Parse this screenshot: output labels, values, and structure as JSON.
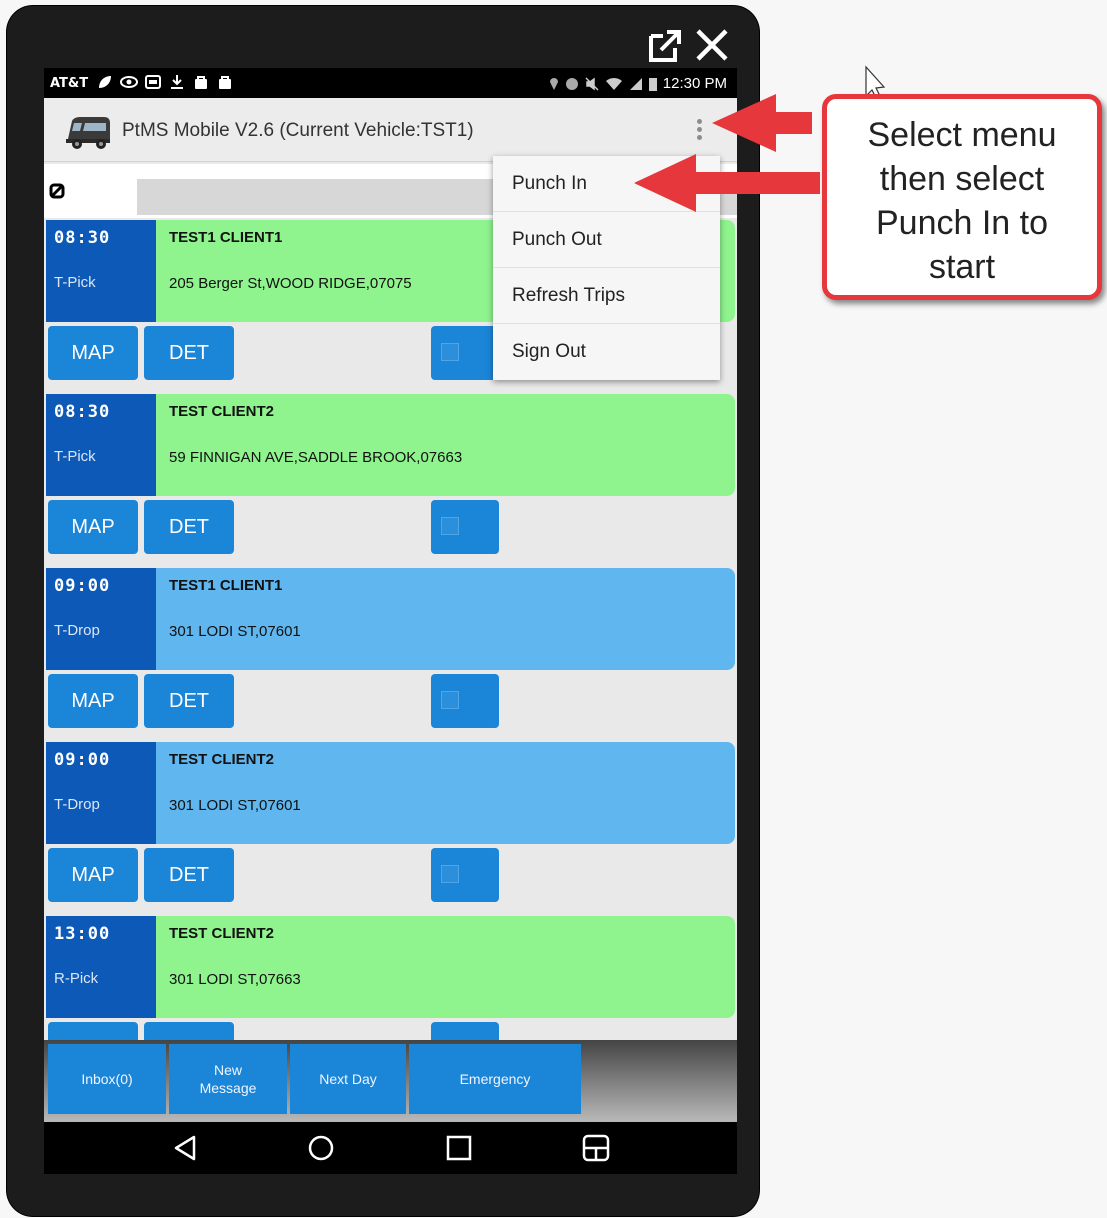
{
  "status_bar": {
    "carrier": "AT&T",
    "time": "12:30 PM"
  },
  "app_bar": {
    "title": "PtMS Mobile V2.6  (Current Vehicle:TST1)"
  },
  "menu": {
    "items": [
      {
        "label": "Punch In"
      },
      {
        "label": "Punch Out"
      },
      {
        "label": "Refresh Trips"
      },
      {
        "label": "Sign Out"
      }
    ]
  },
  "trips": [
    {
      "time": "08:30",
      "type": "T-Pick",
      "name": "TEST1 CLIENT1",
      "address": "205 Berger St,WOOD RIDGE,07075",
      "status_color": "#8ff48e",
      "map_label": "MAP",
      "det_label": "DET"
    },
    {
      "time": "08:30",
      "type": "T-Pick",
      "name": "TEST CLIENT2",
      "address": "59 FINNIGAN AVE,SADDLE BROOK,07663",
      "status_color": "#8ff48e",
      "map_label": "MAP",
      "det_label": "DET"
    },
    {
      "time": "09:00",
      "type": "T-Drop",
      "name": "TEST1 CLIENT1",
      "address": "301 LODI ST,07601",
      "status_color": "#60b6ef",
      "map_label": "MAP",
      "det_label": "DET"
    },
    {
      "time": "09:00",
      "type": "T-Drop",
      "name": "TEST CLIENT2",
      "address": "301 LODI ST,07601",
      "status_color": "#60b6ef",
      "map_label": "MAP",
      "det_label": "DET"
    },
    {
      "time": "13:00",
      "type": "R-Pick",
      "name": "TEST CLIENT2",
      "address": "301 LODI ST,07663",
      "status_color": "#8ff48e"
    }
  ],
  "toolbar": {
    "inbox": "Inbox(0)",
    "new_message_line1": "New",
    "new_message_line2": "Message",
    "next_day": "Next Day",
    "emergency": "Emergency"
  },
  "callout": {
    "line1": "Select menu",
    "line2": "then select",
    "line3": "Punch In to",
    "line4": "start"
  },
  "colors": {
    "accent_blue": "#1b85d8",
    "dark_blue": "#0d59b7",
    "pick_green": "#8ff48e",
    "drop_blue": "#60b6ef",
    "callout_red": "#e6383c"
  },
  "icons": [
    "external-link-icon",
    "close-icon",
    "van-logo-icon",
    "overflow-menu-icon",
    "clear-filter-icon",
    "back-icon",
    "home-icon",
    "recents-icon",
    "split-screen-icon"
  ]
}
